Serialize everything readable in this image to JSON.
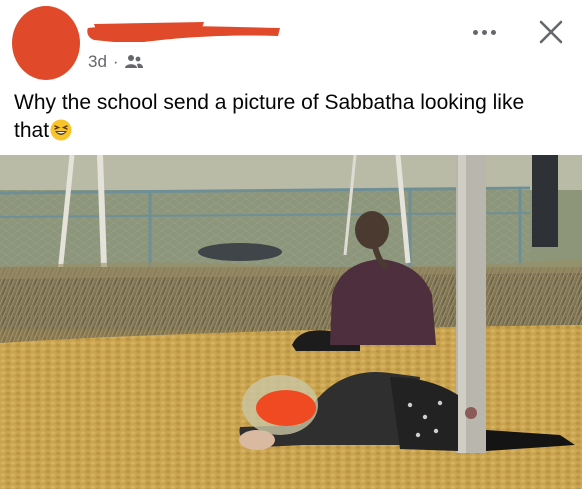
{
  "post": {
    "time": "3d",
    "separator": "·",
    "audience_icon": "friends-icon",
    "caption": "Why the school send a picture of Sabbatha looking like that",
    "emoji": "laughing-emoji"
  },
  "controls": {
    "more_icon": "more-options-icon",
    "close_icon": "close-icon"
  },
  "colors": {
    "redaction": "#e04a2a",
    "meta_text": "#65676b",
    "text": "#050505"
  }
}
